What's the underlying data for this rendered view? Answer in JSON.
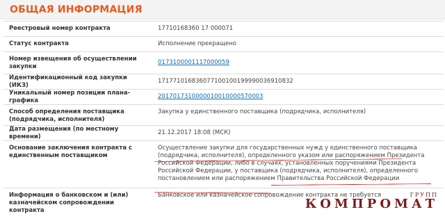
{
  "section": {
    "title": "ОБЩАЯ ИНФОРМАЦИЯ"
  },
  "rows": [
    {
      "label": "Реестровый номер контракта",
      "value": "17710168360 17 000071"
    },
    {
      "label": "Статус контракта",
      "value": "Исполнение прекращено"
    },
    {
      "label": "Номер извещения об осуществлении закупки",
      "value": "0173100001117000059"
    },
    {
      "label": "Идентификационный код закупки (ИКЗ)",
      "value": "171771016836077100100199990036910832"
    },
    {
      "label": "Уникальный номер позиции плана-графика",
      "value": "2017017310000010010000570003"
    },
    {
      "label": "Способ определения поставщика (подрядчика, исполнителя)",
      "value": "Закупка у единственного поставщика (подрядчика, исполнителя)"
    },
    {
      "label": "Дата размещения (по местному времени)",
      "value": "21.12.2017 18:08 (МСК)"
    },
    {
      "label": "Основание заключения контракта с единственным поставщиком",
      "value": "Осуществление закупки для государственных нужд у единственного поставщика (подрядчика, исполнителя), определенного указом или распоряжением Президента Российской Федерации, либо в случаях, установленных поручениями Президента Российской Федерации, у поставщика (подрядчика, исполнителя), определенного постановлением или распоряжением Правительства Российской Федерации"
    },
    {
      "label": "Информация о банковском и (или) казначейском сопровождении контракта",
      "value": "Банковское или казначейское сопровождение контракта не требуется"
    }
  ],
  "watermark": {
    "main": "КОМПРОМАТ",
    "small": "ГРУПП"
  },
  "colors": {
    "header_text": "#e95a1d",
    "link": "#0a6db6",
    "annotation": "#d11a1a"
  }
}
